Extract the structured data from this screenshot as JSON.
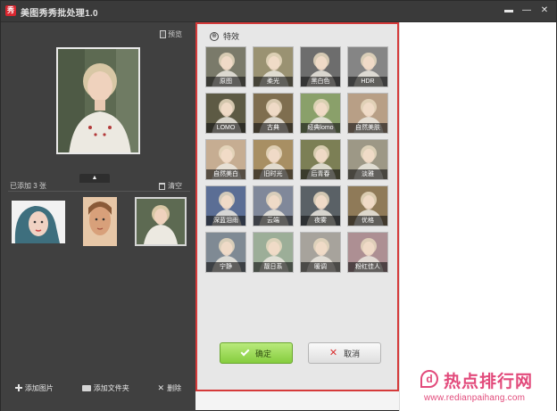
{
  "app": {
    "title": "美图秀秀批处理1.0",
    "icon_char": "秀",
    "window_buttons": [
      "▬",
      "—",
      "✕"
    ]
  },
  "left_panel": {
    "preview_label": "预览",
    "added_count_label": "已添加 3 张",
    "clear_label": "清空",
    "collapse_icon": "▲",
    "bottom_bar": {
      "add_image": "添加图片",
      "add_folder": "添加文件夹",
      "delete": "删除"
    }
  },
  "effects_panel": {
    "title": "特效",
    "back_icon": "⊕",
    "items": [
      "原图",
      "柔光",
      "黑白色",
      "HDR",
      "LOMO",
      "古典",
      "经典lomo",
      "自然美肤",
      "自然美白",
      "旧时光",
      "后青春",
      "淡雅",
      "深蓝泪雨",
      "云端",
      "夜雾",
      "优格",
      "宁静",
      "靓日系",
      "暖调",
      "粉红佳人"
    ],
    "confirm_label": "确定",
    "cancel_label": "取消"
  },
  "watermark": {
    "logo_char": "d",
    "chinese": "热点排行网",
    "url": "www.redianpaihang.com"
  },
  "colors": {
    "accent_red": "#d53a3a",
    "confirm_green": "#86cd3e",
    "dark_panel": "#404040",
    "watermark_pink": "#e24a7b"
  }
}
